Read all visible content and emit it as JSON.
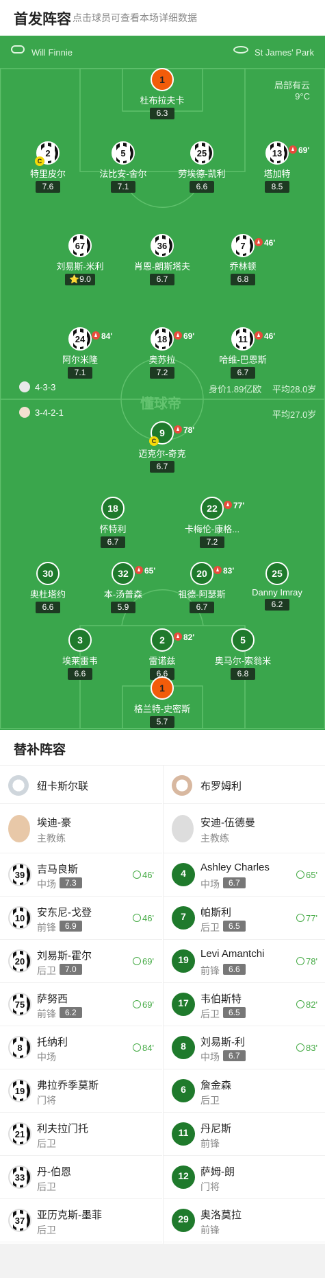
{
  "header": {
    "title": "首发阵容",
    "subtitle": "点击球员可查看本场详细数据"
  },
  "pitch": {
    "referee": "Will Finnie",
    "stadium": "St James' Park",
    "weather": "局部有云",
    "temp": "9°C",
    "watermark": "懂球帝",
    "home_formation": "4-3-3",
    "home_value": "身价1.89亿欧",
    "home_age": "平均28.0岁",
    "away_formation": "3-4-2-1",
    "away_age": "平均27.0岁"
  },
  "home_players": [
    {
      "num": "1",
      "name": "杜布拉夫卡",
      "rating": "6.3",
      "kit": "gk"
    },
    {
      "num": "2",
      "name": "特里皮尔",
      "rating": "7.6",
      "kit": "home",
      "cap": "C"
    },
    {
      "num": "5",
      "name": "法比安-舍尔",
      "rating": "7.1",
      "kit": "home"
    },
    {
      "num": "25",
      "name": "劳埃德-凯利",
      "rating": "6.6",
      "kit": "home"
    },
    {
      "num": "13",
      "name": "塔加特",
      "rating": "8.5",
      "kit": "home",
      "sub": "69'"
    },
    {
      "num": "67",
      "name": "刘易斯-米利",
      "rating": "9.0",
      "kit": "home",
      "star": "⭐"
    },
    {
      "num": "36",
      "name": "肖恩-朗斯塔夫",
      "rating": "6.7",
      "kit": "home"
    },
    {
      "num": "7",
      "name": "乔林顿",
      "rating": "6.8",
      "kit": "home",
      "sub": "46'"
    },
    {
      "num": "24",
      "name": "阿尔米隆",
      "rating": "7.1",
      "kit": "home",
      "sub": "84'"
    },
    {
      "num": "18",
      "name": "奥苏拉",
      "rating": "7.2",
      "kit": "home",
      "sub": "69'"
    },
    {
      "num": "11",
      "name": "哈维-巴恩斯",
      "rating": "6.7",
      "kit": "home",
      "sub": "46'"
    }
  ],
  "away_players": [
    {
      "num": "9",
      "name": "迈克尔-奇克",
      "rating": "6.7",
      "kit": "away",
      "sub": "78'",
      "cap": "C"
    },
    {
      "num": "18",
      "name": "怀特利",
      "rating": "6.7",
      "kit": "away"
    },
    {
      "num": "22",
      "name": "卡梅伦-康格...",
      "rating": "7.2",
      "kit": "away",
      "sub": "77'"
    },
    {
      "num": "30",
      "name": "奥杜塔约",
      "rating": "6.6",
      "kit": "away"
    },
    {
      "num": "32",
      "name": "本-汤普森",
      "rating": "5.9",
      "kit": "away",
      "sub": "65'"
    },
    {
      "num": "20",
      "name": "祖德-阿瑟斯",
      "rating": "6.7",
      "kit": "away",
      "sub": "83'"
    },
    {
      "num": "25",
      "name": "Danny Imray",
      "rating": "6.2",
      "kit": "away"
    },
    {
      "num": "3",
      "name": "埃莱雷韦",
      "rating": "6.6",
      "kit": "away"
    },
    {
      "num": "2",
      "name": "雷诺兹",
      "rating": "6.6",
      "kit": "away",
      "sub": "82'"
    },
    {
      "num": "5",
      "name": "奥马尔-索翁米",
      "rating": "6.8",
      "kit": "away"
    },
    {
      "num": "1",
      "name": "格兰特-史密斯",
      "rating": "5.7",
      "kit": "gk"
    }
  ],
  "subs_title": "替补阵容",
  "home_subs": {
    "team": "纽卡斯尔联",
    "coach_name": "埃迪-豪",
    "coach_role": "主教练",
    "list": [
      {
        "num": "39",
        "name": "吉马良斯",
        "pos": "中场",
        "rating": "7.3",
        "time": "46'"
      },
      {
        "num": "10",
        "name": "安东尼-戈登",
        "pos": "前锋",
        "rating": "6.9",
        "time": "46'"
      },
      {
        "num": "20",
        "name": "刘易斯-霍尔",
        "pos": "后卫",
        "rating": "7.0",
        "time": "69'"
      },
      {
        "num": "75",
        "name": "萨努西",
        "pos": "前锋",
        "rating": "6.2",
        "time": "69'"
      },
      {
        "num": "8",
        "name": "托纳利",
        "pos": "中场",
        "rating": "",
        "time": "84'"
      },
      {
        "num": "19",
        "name": "弗拉乔季莫斯",
        "pos": "门将",
        "rating": "",
        "time": ""
      },
      {
        "num": "21",
        "name": "利夫拉门托",
        "pos": "后卫",
        "rating": "",
        "time": ""
      },
      {
        "num": "33",
        "name": "丹-伯恩",
        "pos": "后卫",
        "rating": "",
        "time": ""
      },
      {
        "num": "37",
        "name": "亚历克斯-墨菲",
        "pos": "后卫",
        "rating": "",
        "time": ""
      }
    ]
  },
  "away_subs": {
    "team": "布罗姆利",
    "coach_name": "安迪-伍德曼",
    "coach_role": "主教练",
    "list": [
      {
        "num": "4",
        "name": "Ashley Charles",
        "pos": "中场",
        "rating": "6.7",
        "time": "65'"
      },
      {
        "num": "7",
        "name": "帕斯利",
        "pos": "后卫",
        "rating": "6.5",
        "time": "77'"
      },
      {
        "num": "19",
        "name": "Levi Amantchi",
        "pos": "前锋",
        "rating": "6.6",
        "time": "78'"
      },
      {
        "num": "17",
        "name": "韦伯斯特",
        "pos": "后卫",
        "rating": "6.5",
        "time": "82'"
      },
      {
        "num": "8",
        "name": "刘易斯-利",
        "pos": "中场",
        "rating": "6.7",
        "time": "83'"
      },
      {
        "num": "6",
        "name": "詹金森",
        "pos": "后卫",
        "rating": "",
        "time": ""
      },
      {
        "num": "11",
        "name": "丹尼斯",
        "pos": "前锋",
        "rating": "",
        "time": ""
      },
      {
        "num": "12",
        "name": "萨姆-朗",
        "pos": "门将",
        "rating": "",
        "time": ""
      },
      {
        "num": "29",
        "name": "奥洛莫拉",
        "pos": "前锋",
        "rating": "",
        "time": ""
      }
    ]
  }
}
